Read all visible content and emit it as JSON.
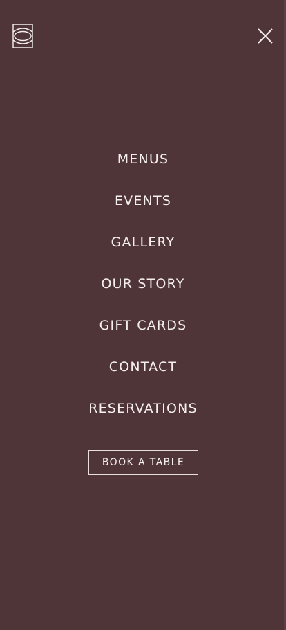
{
  "header": {
    "logo_icon": "brand-logo-icon",
    "close_icon": "close-icon"
  },
  "nav": {
    "items": [
      {
        "label": "MENUS"
      },
      {
        "label": "EVENTS"
      },
      {
        "label": "GALLERY"
      },
      {
        "label": "OUR STORY"
      },
      {
        "label": "GIFT CARDS"
      },
      {
        "label": "CONTACT"
      },
      {
        "label": "RESERVATIONS"
      }
    ]
  },
  "cta": {
    "book_label": "BOOK A TABLE"
  },
  "colors": {
    "background": "#4f3538",
    "text": "#f5f0ee",
    "border": "#e9e0de"
  }
}
